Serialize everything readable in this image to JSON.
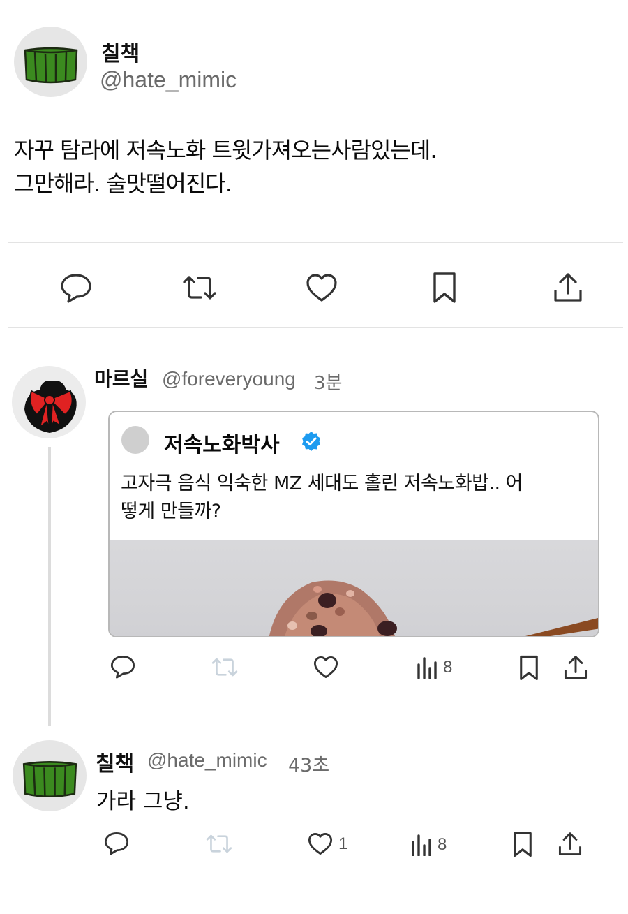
{
  "main_tweet": {
    "display_name": "칠책",
    "handle": "@hate_mimic",
    "text_line1": "자꾸 탐라에 저속노화 트윗가져오는사람있는데.",
    "text_line2": "그만해라. 술맛떨어진다."
  },
  "reply1": {
    "display_name": "마르실",
    "handle": "@foreveryoung",
    "time": "3분",
    "views_count": "8",
    "quoted": {
      "display_name": "저속노화박사",
      "text_line1": "고자극 음식 익숙한 MZ 세대도 홀린 저속노화밥.. 어",
      "text_line2": "떻게 만들까?"
    }
  },
  "reply2": {
    "display_name": "칠책",
    "handle": "@hate_mimic",
    "time": "43초",
    "text": "가라 그냥.",
    "likes_count": "1",
    "views_count": "8"
  },
  "colors": {
    "verified_blue": "#1d9bf0",
    "avatar_green": "#3b8a1f",
    "bow_red": "#e02222",
    "icon_dark": "#333333",
    "icon_faded": "#c9d3dc"
  },
  "icons": [
    "reply-icon",
    "retweet-icon",
    "like-icon",
    "bookmark-icon",
    "share-icon",
    "views-icon",
    "verified-badge-icon"
  ]
}
